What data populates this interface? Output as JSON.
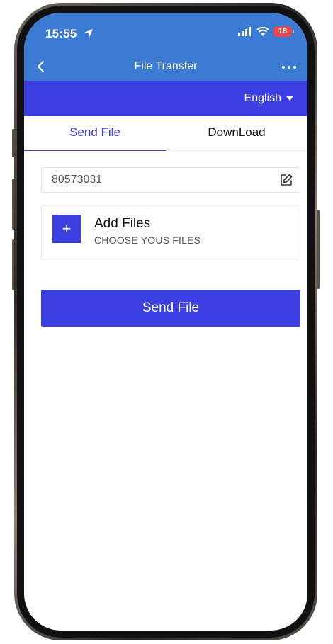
{
  "status_bar": {
    "time": "15:55",
    "battery": "18"
  },
  "nav": {
    "title": "File Transfer"
  },
  "language": {
    "selected": "English"
  },
  "tabs": [
    {
      "label": "Send File",
      "active": true
    },
    {
      "label": "DownLoad",
      "active": false
    }
  ],
  "form": {
    "id_value": "80573031",
    "add_files_title": "Add Files",
    "add_files_subtitle": "CHOOSE YOUS FILES",
    "plus_symbol": "+",
    "send_button": "Send File"
  },
  "colors": {
    "header_blue": "#3b7bd4",
    "accent_blue": "#3b3ee0",
    "battery_red": "#e84a4a"
  }
}
